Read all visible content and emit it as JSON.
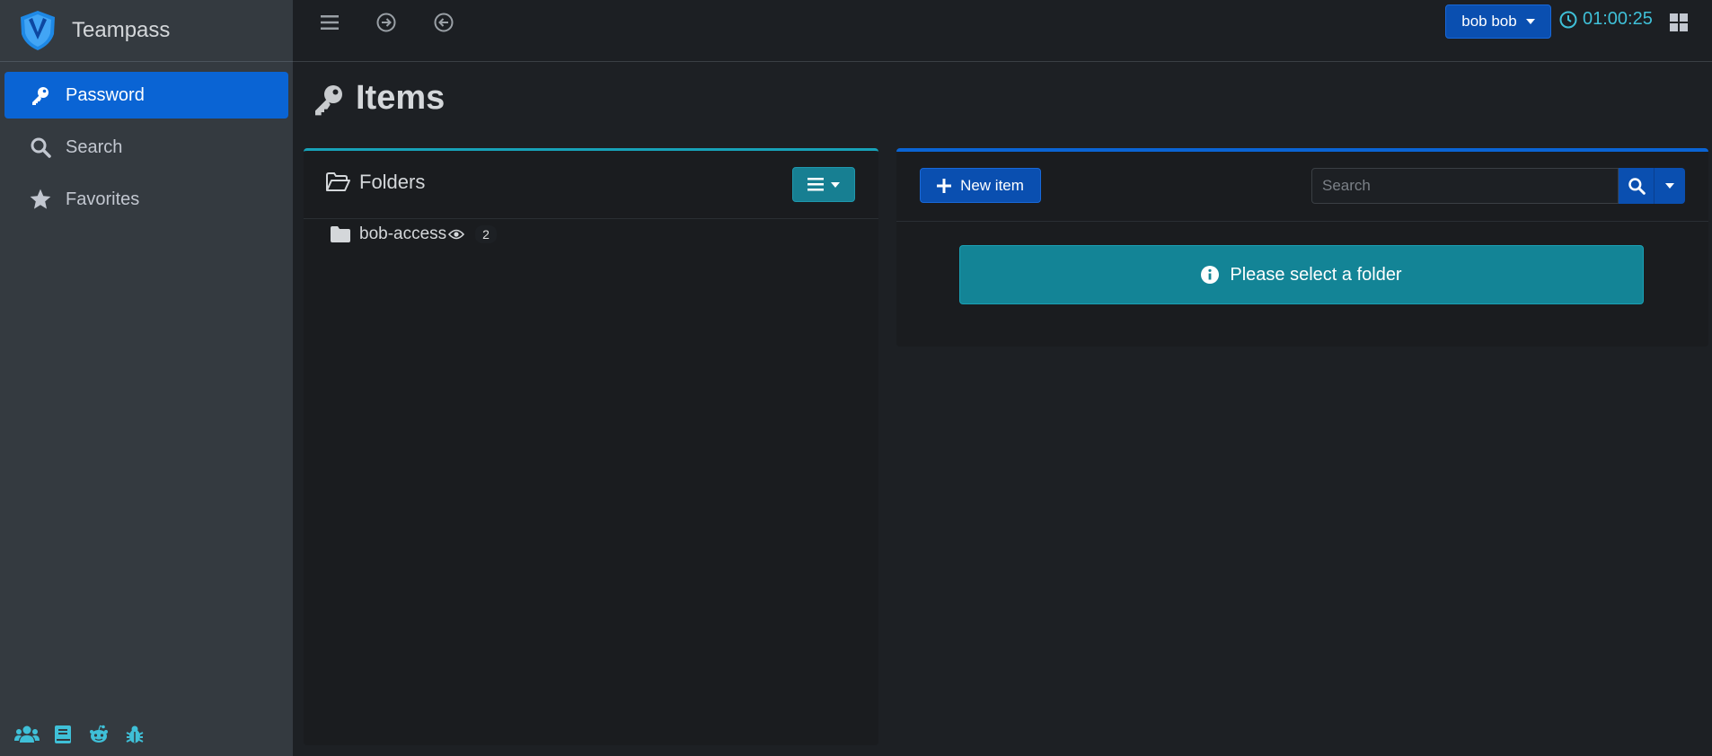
{
  "app": {
    "name": "Teampass"
  },
  "sidebar": {
    "items": [
      {
        "label": "Password",
        "icon": "key-icon",
        "active": true
      },
      {
        "label": "Search",
        "icon": "search-icon",
        "active": false
      },
      {
        "label": "Favorites",
        "icon": "star-icon",
        "active": false
      }
    ],
    "footer_icons": [
      "users-icon",
      "book-icon",
      "reddit-icon",
      "bug-icon"
    ]
  },
  "topbar": {
    "user_label": "bob bob",
    "timer": "01:00:25",
    "icons": [
      "menu-icon",
      "arrow-right-circle-icon",
      "arrow-left-circle-icon",
      "apps-icon"
    ]
  },
  "page": {
    "title": "Items"
  },
  "folders": {
    "title": "Folders",
    "tree": [
      {
        "label": "bob-access",
        "count": "2"
      }
    ]
  },
  "items_panel": {
    "new_item_label": "New item",
    "search_placeholder": "Search",
    "message": "Please select a folder"
  },
  "colors": {
    "accent": "#0a64d4",
    "info": "#17a2b8",
    "timer": "#3fc0d8",
    "sidebar_bg": "#343a40"
  }
}
